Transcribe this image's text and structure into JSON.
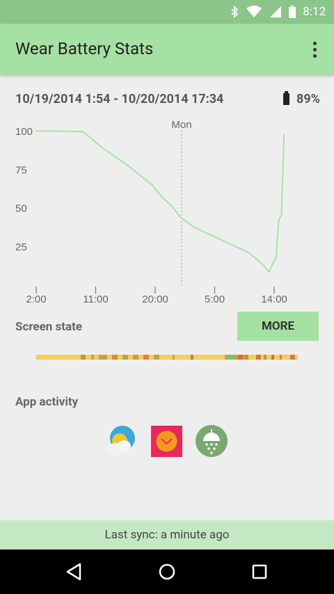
{
  "status_bar": {
    "time": "8:12",
    "icons": [
      "bluetooth-icon",
      "wifi-icon",
      "signal-icon",
      "battery-icon"
    ]
  },
  "app_bar": {
    "title": "Wear Battery Stats",
    "menu_icon": "more-vert-icon"
  },
  "summary": {
    "range": "10/19/2014 1:54 - 10/20/2014 17:34",
    "battery_percent": "89%",
    "battery_level": 0.89
  },
  "chart_data": {
    "type": "line",
    "y_ticks": [
      "100",
      "75",
      "50",
      "25"
    ],
    "ylim": [
      0,
      100
    ],
    "x_ticks": [
      "2:00",
      "11:00",
      "20:00",
      "5:00",
      "14:00"
    ],
    "x_tick_hours": [
      2,
      11,
      20,
      29,
      38
    ],
    "day_marker": {
      "label": "Mon",
      "hour": 24
    },
    "line_color": "#a8e3a4",
    "series": [
      {
        "x": [
          1.9,
          9.0,
          9.5,
          12,
          14,
          16,
          18,
          19.5,
          21,
          22.5,
          24,
          26,
          28,
          30,
          32,
          34,
          35.5,
          36.5,
          37.2,
          38.3,
          38.7,
          39.1,
          39.5
        ],
        "y": [
          100,
          99.5,
          98,
          89,
          83,
          77,
          70,
          65,
          57,
          51,
          43,
          37,
          33,
          29,
          25,
          21,
          16,
          12,
          8,
          18,
          42,
          45,
          98
        ]
      }
    ]
  },
  "screen_state": {
    "label": "Screen state",
    "more_label": "MORE",
    "base_color": "#f2cf5b",
    "segments": [
      {
        "start": 0.17,
        "end": 0.19,
        "color": "#b69a52"
      },
      {
        "start": 0.21,
        "end": 0.22,
        "color": "#c9a24a"
      },
      {
        "start": 0.24,
        "end": 0.27,
        "color": "#bfa056"
      },
      {
        "start": 0.29,
        "end": 0.31,
        "color": "#d08e3e"
      },
      {
        "start": 0.33,
        "end": 0.35,
        "color": "#b8a05a"
      },
      {
        "start": 0.37,
        "end": 0.39,
        "color": "#c99d48"
      },
      {
        "start": 0.41,
        "end": 0.43,
        "color": "#d6843a"
      },
      {
        "start": 0.45,
        "end": 0.47,
        "color": "#bfa056"
      },
      {
        "start": 0.52,
        "end": 0.53,
        "color": "#c9a24a"
      },
      {
        "start": 0.59,
        "end": 0.6,
        "color": "#9a8e5c"
      },
      {
        "start": 0.72,
        "end": 0.8,
        "color": "#c0a151"
      },
      {
        "start": 0.73,
        "end": 0.76,
        "color": "#8dbd62"
      },
      {
        "start": 0.77,
        "end": 0.79,
        "color": "#d96f3b"
      },
      {
        "start": 0.8,
        "end": 0.81,
        "color": "#d98a3a"
      },
      {
        "start": 0.84,
        "end": 0.86,
        "color": "#cf7b3f"
      },
      {
        "start": 0.87,
        "end": 0.88,
        "color": "#b5994e"
      },
      {
        "start": 0.9,
        "end": 0.91,
        "color": "#d66e35"
      },
      {
        "start": 0.93,
        "end": 0.94,
        "color": "#c98b44"
      },
      {
        "start": 0.97,
        "end": 0.99,
        "color": "#cf7e3c"
      }
    ]
  },
  "app_activity": {
    "label": "App activity",
    "apps": [
      "weather-app-icon",
      "clock-app-icon",
      "shower-app-icon"
    ]
  },
  "sync": {
    "text": "Last sync: a minute ago"
  },
  "nav": {
    "back": "back-icon",
    "home": "home-icon",
    "recents": "recents-icon"
  }
}
